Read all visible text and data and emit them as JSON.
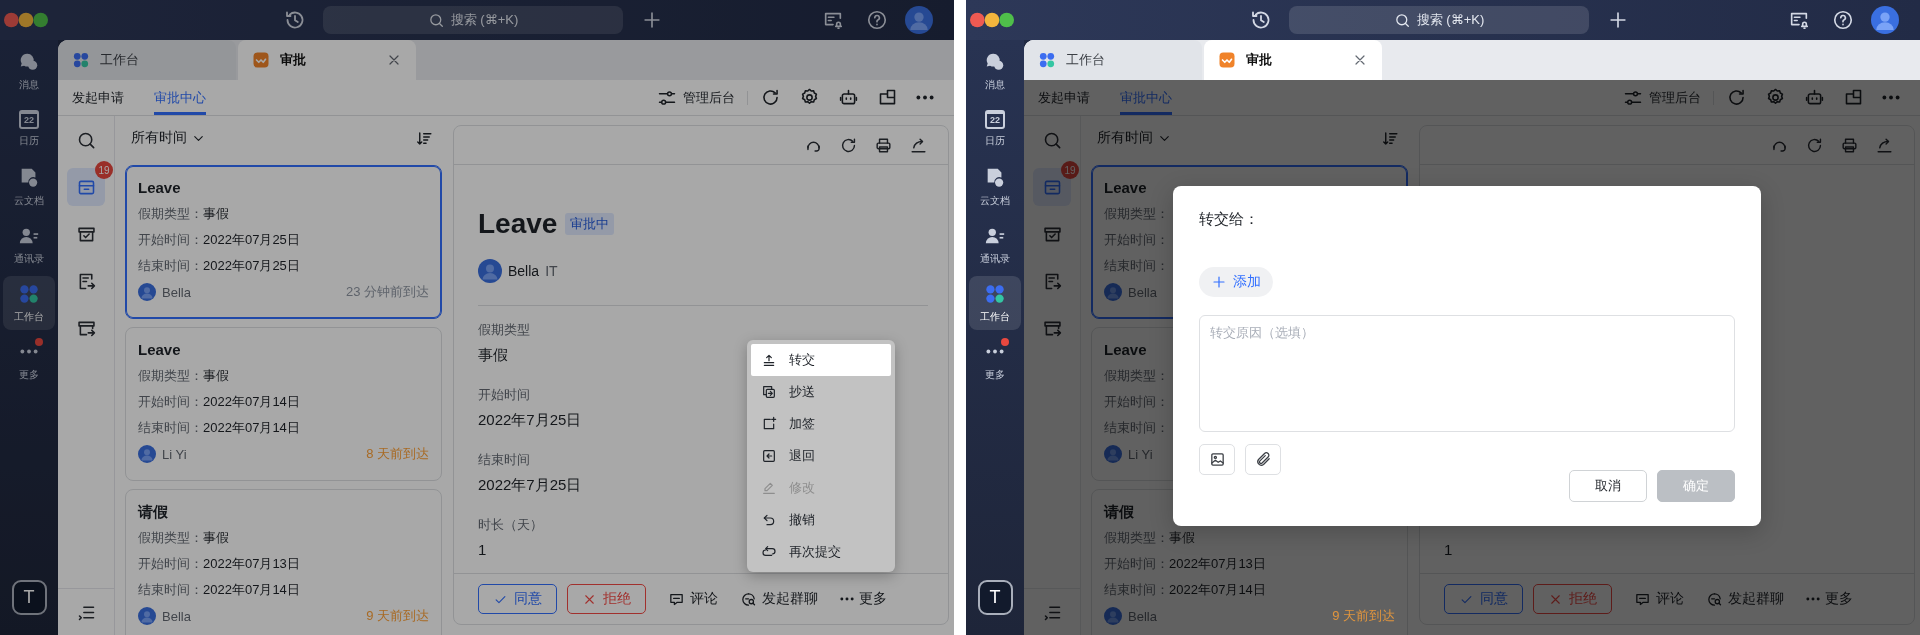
{
  "screens": [
    {
      "search": {
        "placeholder": "搜索 (⌘+K)"
      },
      "sidebar": {
        "items": [
          {
            "kind": "chat",
            "label": "消息",
            "selected": false,
            "dot": false
          },
          {
            "kind": "calendar",
            "label": "日历",
            "day": "22",
            "selected": false,
            "dot": false
          },
          {
            "kind": "docs",
            "label": "云文档",
            "selected": false,
            "dot": false
          },
          {
            "kind": "contacts",
            "label": "通讯录",
            "selected": false,
            "dot": false
          },
          {
            "kind": "workbench",
            "label": "工作台",
            "selected": true,
            "dot": false
          },
          {
            "kind": "more",
            "label": "更多",
            "selected": false,
            "dot": true
          }
        ],
        "user_initial": "T"
      },
      "tabs": [
        {
          "kind": "workbench",
          "label": "工作台",
          "selected": false,
          "closable": false
        },
        {
          "kind": "approval",
          "label": "审批",
          "selected": true,
          "closable": true
        }
      ],
      "nav": {
        "tabs": [
          {
            "label": "发起申请",
            "selected": false
          },
          {
            "label": "审批中心",
            "selected": true
          }
        ],
        "admin": "管理后台"
      },
      "rail": [
        {
          "kind": "search",
          "selected": false
        },
        {
          "kind": "inbox",
          "selected": true,
          "badge": "19"
        },
        {
          "kind": "done",
          "selected": false
        },
        {
          "kind": "cc",
          "selected": false
        },
        {
          "kind": "sent",
          "selected": false
        }
      ],
      "list": {
        "filter": "所有时间",
        "cards": [
          {
            "title": "Leave",
            "selected": true,
            "fields": [
              {
                "label": "假期类型：",
                "value": "事假"
              },
              {
                "label": "开始时间：",
                "value": "2022年07月25日"
              },
              {
                "label": "结束时间：",
                "value": "2022年07月25日"
              }
            ],
            "user": "Bella",
            "time": "23 分钟前到达",
            "color": "#5e636b"
          },
          {
            "title": "Leave",
            "selected": false,
            "fields": [
              {
                "label": "假期类型：",
                "value": "事假"
              },
              {
                "label": "开始时间：",
                "value": "2022年07月14日"
              },
              {
                "label": "结束时间：",
                "value": "2022年07月14日"
              }
            ],
            "user": "Li Yi",
            "time": "8 天前到达",
            "color": "#a86a24"
          },
          {
            "title": "请假",
            "selected": false,
            "fields": [
              {
                "label": "假期类型：",
                "value": "事假"
              },
              {
                "label": "开始时间：",
                "value": "2022年07月13日"
              },
              {
                "label": "结束时间：",
                "value": "2022年07月14日"
              }
            ],
            "user": "Bella",
            "time": "9 天前到达",
            "color": "#a86a24"
          }
        ]
      },
      "detail": {
        "title": "Leave",
        "status": "审批中",
        "user": "Bella",
        "dept": "IT",
        "fields": [
          {
            "label": "假期类型",
            "value": "事假"
          },
          {
            "label": "开始时间",
            "value": "2022年7月25日"
          },
          {
            "label": "结束时间",
            "value": "2022年7月25日"
          },
          {
            "label": "时长（天）",
            "value": "1"
          }
        ],
        "actions": [
          {
            "kind": "approve",
            "label": "同意"
          },
          {
            "kind": "reject",
            "label": "拒绝"
          },
          {
            "kind": "comment",
            "label": "评论"
          },
          {
            "kind": "chat",
            "label": "发起群聊"
          },
          {
            "kind": "more",
            "label": "更多"
          }
        ]
      },
      "overlay": {
        "kind": "menu",
        "items": [
          {
            "kind": "transfer",
            "label": "转交",
            "selected": true,
            "disabled": false
          },
          {
            "kind": "cc",
            "label": "抄送",
            "selected": false,
            "disabled": false
          },
          {
            "kind": "addsign",
            "label": "加签",
            "selected": false,
            "disabled": false
          },
          {
            "kind": "back",
            "label": "退回",
            "selected": false,
            "disabled": false
          },
          {
            "kind": "edit",
            "label": "修改",
            "selected": false,
            "disabled": true
          },
          {
            "kind": "undo",
            "label": "撤销",
            "selected": false,
            "disabled": false
          },
          {
            "kind": "resubmit",
            "label": "再次提交",
            "selected": false,
            "disabled": false
          }
        ]
      }
    },
    {
      "search": {
        "placeholder": "搜索 (⌘+K)"
      },
      "sidebar": {
        "items": [
          {
            "kind": "chat",
            "label": "消息",
            "selected": false,
            "dot": false
          },
          {
            "kind": "calendar",
            "label": "日历",
            "day": "22",
            "selected": false,
            "dot": false
          },
          {
            "kind": "docs",
            "label": "云文档",
            "selected": false,
            "dot": false
          },
          {
            "kind": "contacts",
            "label": "通讯录",
            "selected": false,
            "dot": false
          },
          {
            "kind": "workbench",
            "label": "工作台",
            "selected": true,
            "dot": false
          },
          {
            "kind": "more",
            "label": "更多",
            "selected": false,
            "dot": true
          }
        ],
        "user_initial": "T"
      },
      "tabs": [
        {
          "kind": "workbench",
          "label": "工作台",
          "selected": false,
          "closable": false
        },
        {
          "kind": "approval",
          "label": "审批",
          "selected": true,
          "closable": true
        }
      ],
      "nav": {
        "tabs": [
          {
            "label": "发起申请",
            "selected": false
          },
          {
            "label": "审批中心",
            "selected": true
          }
        ],
        "admin": "管理后台"
      },
      "rail": [
        {
          "kind": "search",
          "selected": false
        },
        {
          "kind": "inbox",
          "selected": true,
          "badge": "19"
        },
        {
          "kind": "done",
          "selected": false
        },
        {
          "kind": "cc",
          "selected": false
        },
        {
          "kind": "sent",
          "selected": false
        }
      ],
      "list": {
        "filter": "所有时间",
        "cards": [
          {
            "title": "Leave",
            "selected": true,
            "fields": [
              {
                "label": "假期类型："
              },
              {
                "label": "开始时间："
              },
              {
                "label": "结束时间："
              }
            ],
            "user": "Bella"
          },
          {
            "title": "Leave",
            "selected": false,
            "fields": [
              {
                "label": "假期类型："
              },
              {
                "label": "开始时间："
              },
              {
                "label": "结束时间："
              }
            ],
            "user": "Li Yi"
          },
          {
            "title": "请假",
            "selected": false,
            "fields": [
              {
                "label": "假期类型：",
                "value": "事假"
              },
              {
                "label": "开始时间：",
                "value": "2022年07月13日"
              },
              {
                "label": "结束时间：",
                "value": "2022年07月14日"
              }
            ],
            "user": "Bella",
            "time": "9 天前到达",
            "color": "#e0953e"
          }
        ]
      },
      "detail": {
        "fields": [
          {
            "value": "1"
          }
        ],
        "actions": [
          {
            "kind": "approve",
            "label": "同意"
          },
          {
            "kind": "reject",
            "label": "拒绝"
          },
          {
            "kind": "comment",
            "label": "评论"
          },
          {
            "kind": "chat",
            "label": "发起群聊"
          },
          {
            "kind": "more",
            "label": "更多"
          }
        ]
      },
      "overlay": {
        "kind": "dialog",
        "title": "转交给：",
        "add": "添加",
        "placeholder": "转交原因（选填）",
        "buttons": [
          {
            "kind": "cancel",
            "label": "取消",
            "disabled": false
          },
          {
            "kind": "confirm",
            "label": "确定",
            "disabled": true
          }
        ]
      }
    }
  ]
}
